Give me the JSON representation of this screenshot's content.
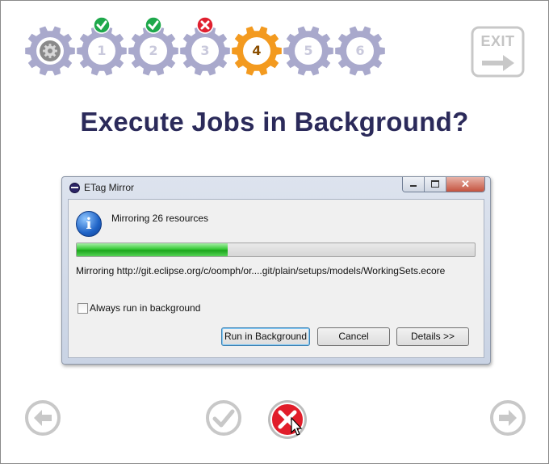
{
  "steps": [
    {
      "label": "",
      "state": "done",
      "icon": "gear-settings-icon"
    },
    {
      "label": "1",
      "state": "done",
      "badge": "success"
    },
    {
      "label": "2",
      "state": "done",
      "badge": "success"
    },
    {
      "label": "3",
      "state": "done",
      "badge": "error"
    },
    {
      "label": "4",
      "state": "current"
    },
    {
      "label": "5",
      "state": "pending"
    },
    {
      "label": "6",
      "state": "pending"
    }
  ],
  "exit_label": "EXIT",
  "title": "Execute Jobs in Background?",
  "dialog": {
    "window_title": "ETag Mirror",
    "message": "Mirroring 26 resources",
    "progress": 0.38,
    "detail": "Mirroring http://git.eclipse.org/c/oomph/or....git/plain/setups/models/WorkingSets.ecore",
    "checkbox_label": "Always run in background",
    "checkbox_checked": false,
    "buttons": {
      "run_in_background": "Run in Background",
      "cancel": "Cancel",
      "details": "Details >>"
    }
  },
  "colors": {
    "gear_done": "#a9a9cc",
    "gear_current": "#f39a1f",
    "title": "#2b2a5a",
    "success_badge": "#1ea84b",
    "error_badge": "#e0202f"
  }
}
